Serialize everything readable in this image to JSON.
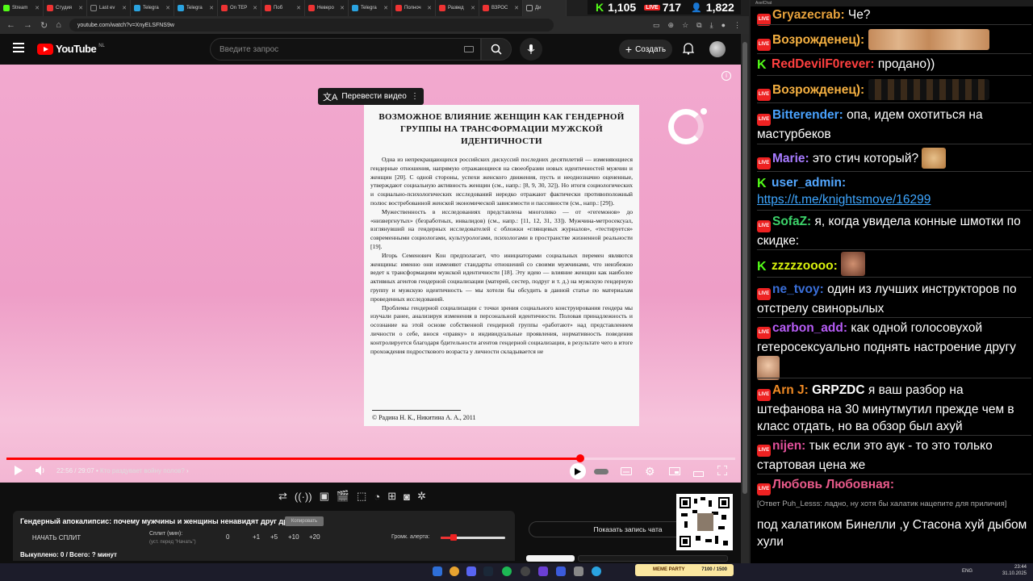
{
  "browser": {
    "tabs": [
      "Stream",
      "Студия",
      "Last ev",
      "Telegra",
      "Telegra",
      "On TEP",
      "Поб",
      "Неверо",
      "Telegra",
      "Полноч",
      "Развед",
      "ВЗРОС",
      "Ди"
    ],
    "url": "youtube.com/watch?v=XnyELSFNS9w"
  },
  "stats": {
    "kick": "1,105",
    "live": "717",
    "viewers": "1,822"
  },
  "youtube": {
    "logo_text": "YouTube",
    "region": "NL",
    "search_placeholder": "Введите запрос",
    "create_label": "Создать"
  },
  "video": {
    "translate_label": "Перевести видео",
    "doc_title": "ВОЗМОЖНОЕ ВЛИЯНИЕ ЖЕНЩИН КАК ГЕНДЕРНОЙ ГРУППЫ НА ТРАНСФОРМАЦИИ МУЖСКОЙ ИДЕНТИЧНОСТИ",
    "doc_paragraphs": [
      "Одна из непрекращающихся российских дискуссий последних десятилетий — изменяющиеся гендерные отношения, напрямую отражающиеся на своеобразии новых идентичностей мужчин и женщин [20]. С одной стороны, успехи женского движения, пусть и неоднозначно оцененные, утверждают социальную активность женщин (см., напр.: [8, 9, 30, 32]). Но итоги социологических и социально-психологических исследований нередко отражают фактически противоположный полюс востребованной женской экономической зависимости и пассивности (см., напр.: [29]).",
      "Мужественность в исследованиях представлена многолико — от «гегемонов» до «низвергнутых» (безработных, инвалидов) (см., напр.: [11, 12, 31, 33]). Мужчина-метросексуал, взглянувший на гендерных исследователей с обложки «глянцевых журналов», «тестируется» современными социологами, культурологами, психологами в пространстве жизненной реальности [19].",
      "Игорь Семенович Кон предполагает, что инициаторами социальных перемен являются женщины: именно они изменяют стандарты отношений со своими мужчинами, что неизбежно ведет к трансформациям мужской идентичности [18]. Эту идею — влияние женщин как наиболее активных агентов гендерной социализации (матерей, сестер, подруг и т. д.) на мужскую гендерную группу и мужскую идентичность — мы хотели бы обсудить в данной статье по материалам проведенных исследований.",
      "Проблемы гендерной социализации с точки зрения социального конструирования гендера мы изучали ранее, анализируя изменения в персональной идентичности. Половая принадлежность и осознание на этой основе собственной гендерной группы «работают» над представлением личности о себе, внося «правку» в индивидуальные проявления, нормативность поведения контролируется благодаря бдительности агентов гендерной социализации, в результате чего в итоге прохождения подросткового возраста у личности складывается не"
    ],
    "doc_footer": "© Радина Н. К., Никитина А. А., 2011",
    "time_current": "22:56",
    "time_total": "29:07",
    "chapter": "Кто раздувает войну полов?",
    "progress": 0.787
  },
  "split": {
    "title": "Гендерный апокалипсис: почему мужчины и женщины ненавидят друг друга",
    "copy_label": "Копировать",
    "start_label": "НАЧАТЬ СПЛИТ",
    "split_min_label": "Сплит (мин):",
    "split_hint": "(уст. перед \"Начать\")",
    "split_value": "0",
    "inc_1": "+1",
    "inc_5": "+5",
    "inc_10": "+10",
    "inc_20": "+20",
    "volume_label": "Громк. алерта:",
    "volume_level": 0.2,
    "bought": "Выкуплено: 0 / Всего: ? минут",
    "show_button": "Показать запись чата"
  },
  "chat": {
    "header": "AxelChat",
    "messages": [
      {
        "nick": "Gryazecrab:",
        "color": "#e8a33d",
        "text": "Че?",
        "platform": "live"
      },
      {
        "nick": "Возрожденец):",
        "color": "#f5b041",
        "text": "",
        "platform": "live"
      },
      {
        "nick": "RedDevilF0rever:",
        "color": "#ff4040",
        "text": "продано))",
        "platform": "kick"
      },
      {
        "nick": "Возрожденец):",
        "color": "#f5b041",
        "text": "",
        "platform": "live"
      },
      {
        "nick": "Bitterender:",
        "color": "#4aa3ff",
        "text": "опа, идем охотиться на мастурбеков",
        "platform": "live"
      },
      {
        "nick": "Marie:",
        "color": "#a77bff",
        "text": "это стич который?",
        "platform": "live"
      },
      {
        "nick": "user_admin:",
        "color": "#53a7ff",
        "text": "https://t.me/knightsmove/16299",
        "platform": "kick"
      },
      {
        "nick": "SofaZ:",
        "color": "#3cd36a",
        "text": "я, когда увидела конные шмотки по скидке:",
        "platform": "live"
      },
      {
        "nick": "zzzzzoooo:",
        "color": "#d9f20d",
        "text": "",
        "platform": "kick"
      },
      {
        "nick": "ne_tvoy:",
        "color": "#3a6fd9",
        "text": "один из лучших инструкторов по отстрелу свинорылых",
        "platform": "live"
      },
      {
        "nick": "carbon_add:",
        "color": "#b65cf5",
        "text": "как одной голосовухой гетеросексуально поднять настроение другу",
        "platform": "live"
      },
      {
        "nick": "Arn J:",
        "color": "#f08a24",
        "text": "GRPZDC",
        "text2": "я ваш разбор на штефанова на 30 минутмутил прежде чем в класс отдать, но ва обзор был ахуй",
        "platform": "live"
      },
      {
        "nick": "nijen:",
        "color": "#e0509a",
        "text": "тык если это аук - то это только стартовая цена же",
        "platform": "live"
      },
      {
        "nick": "Любовь Любовная:",
        "color": "#e85a8a",
        "reply": "[Ответ Puh_Lesss: ладно, ну хотя бы халатик нацепите для приличия]",
        "text": "под халатиком Бинелли ,у Стасона хуй дыбом хули",
        "platform": "live"
      }
    ]
  },
  "taskbar": {
    "meme": "MEME PARTY",
    "meme_value": "7100 / 1500",
    "lang": "ENG",
    "time": "23:44",
    "date": "31.10.2025"
  }
}
